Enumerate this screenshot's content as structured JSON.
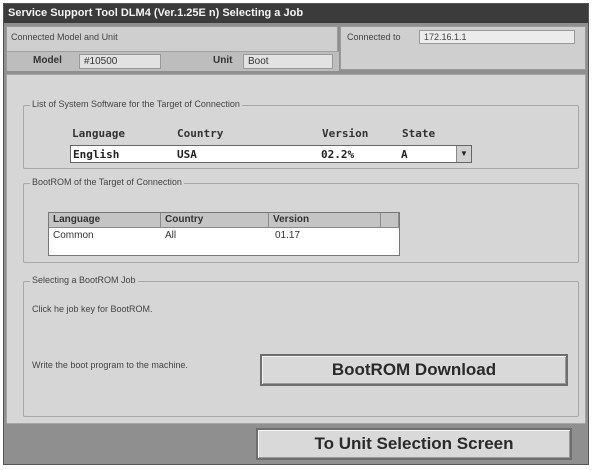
{
  "window": {
    "title": "Service Support Tool DLM4 (Ver.1.25E n) Selecting a Job"
  },
  "status": {
    "connected_label": "Connected Model and Unit",
    "model_label": "Model",
    "model_value": "#10500",
    "unit_label": "Unit",
    "unit_value": "Boot",
    "connected_to_label": "Connected to",
    "connected_to_value": "172.16.1.1"
  },
  "system_software": {
    "title": "List of System Software for the Target of Connection",
    "headers": {
      "language": "Language",
      "country": "Country",
      "version": "Version",
      "state": "State"
    },
    "selected": {
      "language": "English",
      "country": "USA",
      "version": "02.2%",
      "state": "A"
    }
  },
  "bootrom": {
    "title": "BootROM of the Target of Connection",
    "headers": {
      "language": "Language",
      "country": "Country",
      "version": "Version"
    },
    "rows": [
      {
        "language": "Common",
        "country": "All",
        "version": "01.17"
      }
    ]
  },
  "job": {
    "title": "Selecting a BootROM Job",
    "instruction": "Click he job key for BootROM.",
    "write_label": "Write the boot program to the machine.",
    "download_button": "BootROM Download"
  },
  "footer": {
    "unit_selection_button": "To Unit Selection Screen"
  },
  "icons": {
    "dropdown": "chevron-down-icon"
  },
  "colors": {
    "titlebar": "#3b3b3b",
    "window_frame": "#8f8f8f",
    "panel": "#d6d6d6",
    "button_face": "#d9d9d9"
  }
}
